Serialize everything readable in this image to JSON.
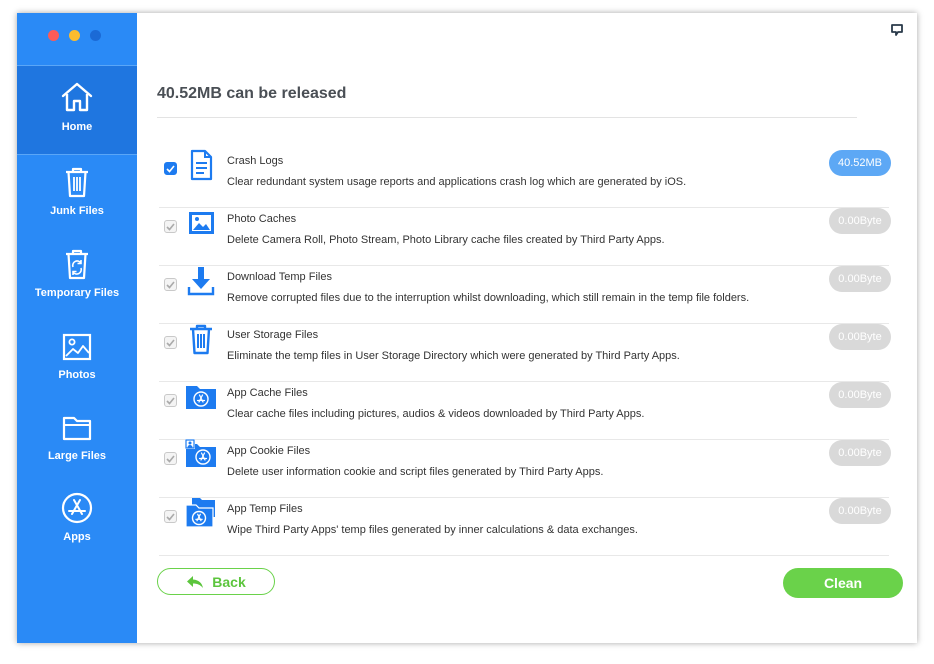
{
  "window": {
    "traffic_lights": {
      "close": "#fc5b57",
      "minimize": "#fdbc2e",
      "maximize": "#1b6ad6"
    }
  },
  "sidebar": {
    "items": [
      {
        "label": "Home",
        "icon": "home-icon",
        "active": true
      },
      {
        "label": "Junk Files",
        "icon": "trash-icon",
        "active": false
      },
      {
        "label": "Temporary Files",
        "icon": "temporary-files-icon",
        "active": false
      },
      {
        "label": "Photos",
        "icon": "photo-icon",
        "active": false
      },
      {
        "label": "Large Files",
        "icon": "folder-icon",
        "active": false
      },
      {
        "label": "Apps",
        "icon": "app-store-icon",
        "active": false
      }
    ]
  },
  "main": {
    "title": "40.52MB can be released",
    "rows": [
      {
        "name": "Crash Logs",
        "description": "Clear redundant system usage reports and applications crash log which are generated by iOS.",
        "size": "40.52MB",
        "checked": true,
        "icon": "document-icon"
      },
      {
        "name": "Photo Caches",
        "description": "Delete Camera Roll, Photo Stream, Photo Library cache files created by Third Party Apps.",
        "size": "0.00Byte",
        "checked": true,
        "icon": "image-icon"
      },
      {
        "name": "Download Temp Files",
        "description": "Remove corrupted files due to the interruption whilst downloading, which still remain in the temp file folders.",
        "size": "0.00Byte",
        "checked": true,
        "icon": "download-icon"
      },
      {
        "name": "User Storage Files",
        "description": "Eliminate the temp files in User Storage Directory which were generated by Third Party Apps.",
        "size": "0.00Byte",
        "checked": true,
        "icon": "trash-can-icon"
      },
      {
        "name": "App Cache Files",
        "description": "Clear cache files including pictures, audios & videos downloaded by Third Party Apps.",
        "size": "0.00Byte",
        "checked": true,
        "icon": "app-folder-icon"
      },
      {
        "name": "App Cookie Files",
        "description": "Delete user information cookie and script files generated by Third Party Apps.",
        "size": "0.00Byte",
        "checked": true,
        "icon": "app-cookie-folder-icon"
      },
      {
        "name": "App Temp Files",
        "description": "Wipe Third Party Apps' temp files generated by inner calculations & data exchanges.",
        "size": "0.00Byte",
        "checked": true,
        "icon": "app-temp-folder-icon"
      }
    ]
  },
  "footer": {
    "back_label": "Back",
    "clean_label": "Clean"
  },
  "colors": {
    "sidebar": "#2a8af6",
    "sidebar_active": "#1f76e0",
    "accent_green": "#6ad24a",
    "accent_blue": "#1d7bf0",
    "badge_inactive": "#d9d9d9"
  }
}
